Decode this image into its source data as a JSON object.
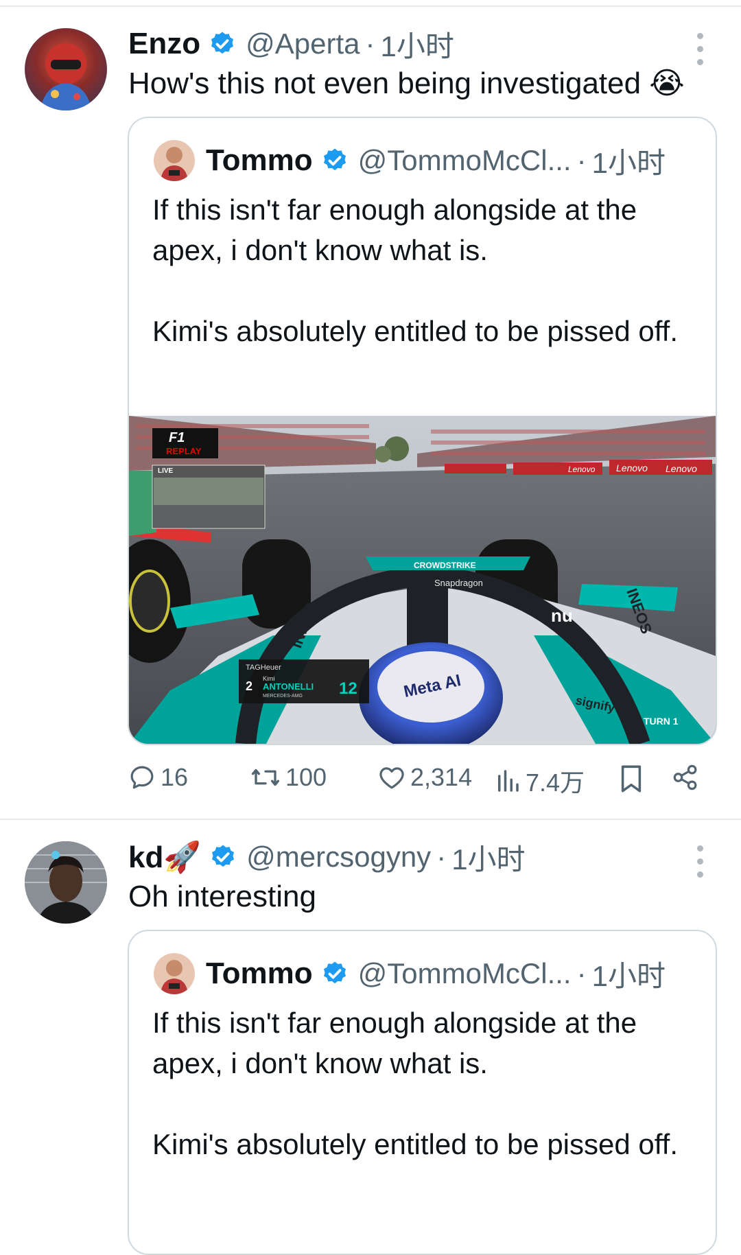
{
  "tweets": [
    {
      "author": {
        "name": "Enzo",
        "handle": "@Aperta",
        "time": "1小时"
      },
      "text": "How's this not even being investigated 😭",
      "quote": {
        "author": {
          "name": "Tommo",
          "handle": "@TommoMcCl...",
          "time": "1小时"
        },
        "paragraphs": [
          "If this isn't far enough alongside at the apex, i don't know what is.",
          "Kimi's absolutely entitled to be pissed off."
        ],
        "media": {
          "overlay_brand": "F1",
          "overlay_replay": "REPLAY",
          "overlay_live": "LIVE",
          "banner_text": "Lenovo",
          "halo_text": "Snapdragon",
          "halo_top": "CROWDSTRIKE",
          "helmet_text": "Meta AI",
          "sponsor_left": "INEOS",
          "sponsor_right": "INEOS",
          "graphic_sponsor": "TAGHeuer",
          "driver_position": "2",
          "driver_first": "Kimi",
          "driver_last": "ANTONELLI",
          "driver_team": "MERCEDES-AMG",
          "driver_number": "12",
          "corner": "TURN 1",
          "signify": "signify"
        }
      },
      "stats": {
        "replies": "16",
        "retweets": "100",
        "likes": "2,314",
        "views": "7.4万"
      }
    },
    {
      "author": {
        "name": "kd🚀",
        "handle": "@mercsogyny",
        "time": "1小时"
      },
      "text": "Oh interesting",
      "quote": {
        "author": {
          "name": "Tommo",
          "handle": "@TommoMcCl...",
          "time": "1小时"
        },
        "paragraphs": [
          "If this isn't far enough alongside at the apex, i don't know what is.",
          "Kimi's absolutely entitled to be pissed off."
        ]
      }
    }
  ],
  "dot_separator": "·",
  "colors": {
    "accent": "#1d9bf0",
    "secondary_text": "#536471",
    "border": "#cfd9de"
  }
}
